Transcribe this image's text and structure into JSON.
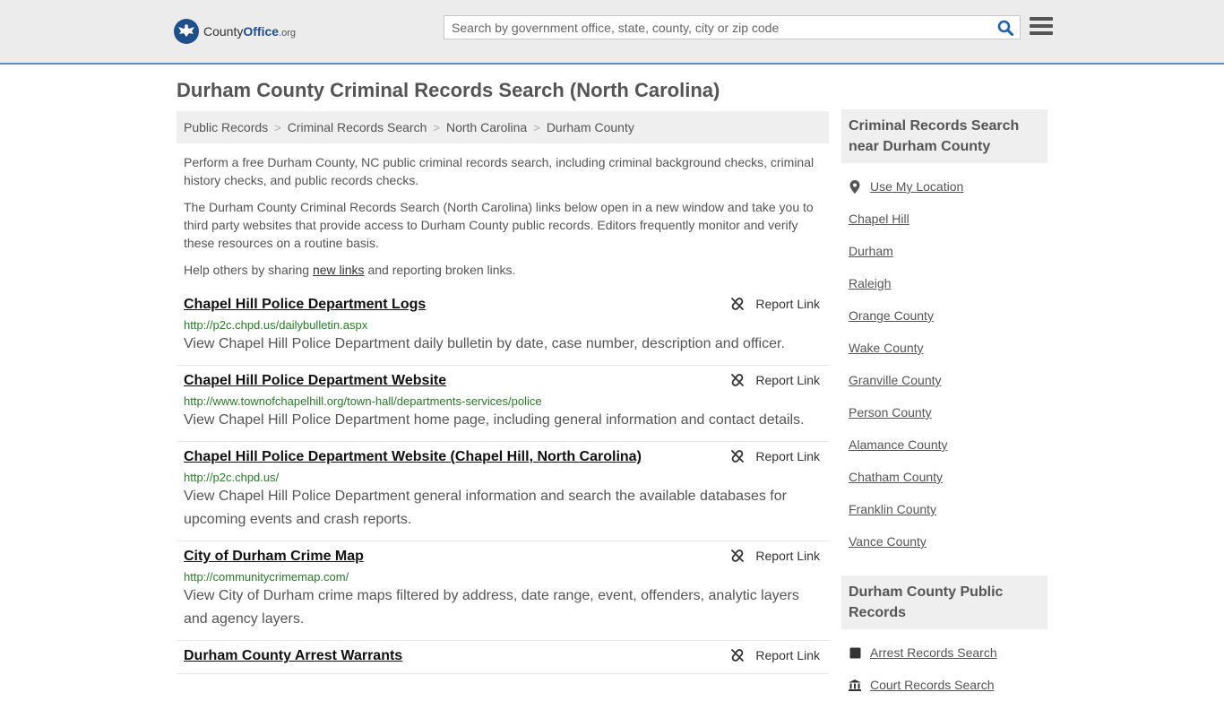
{
  "header": {
    "logo": {
      "county": "County",
      "office": "Office",
      "tld": ".org"
    },
    "search": {
      "placeholder": "Search by government office, state, county, city or zip code"
    }
  },
  "page": {
    "title": "Durham County Criminal Records Search (North Carolina)"
  },
  "breadcrumb": [
    "Public Records",
    "Criminal Records Search",
    "North Carolina",
    "Durham County"
  ],
  "intro": {
    "p1": "Perform a free Durham County, NC public criminal records search, including criminal background checks, criminal history checks, and public records checks.",
    "p2": "The Durham County Criminal Records Search (North Carolina) links below open in a new window and take you to third party websites that provide access to Durham County public records. Editors frequently monitor and verify these resources on a routine basis.",
    "p3_pre": "Help others by sharing ",
    "p3_link": "new links",
    "p3_post": " and reporting broken links."
  },
  "report_label": "Report Link",
  "results": [
    {
      "title": "Chapel Hill Police Department Logs",
      "url": "http://p2c.chpd.us/dailybulletin.aspx",
      "desc": "View Chapel Hill Police Department daily bulletin by date, case number, description and officer."
    },
    {
      "title": "Chapel Hill Police Department Website",
      "url": "http://www.townofchapelhill.org/town-hall/departments-services/police",
      "desc": "View Chapel Hill Police Department home page, including general information and contact details."
    },
    {
      "title": "Chapel Hill Police Department Website (Chapel Hill, North Carolina)",
      "url": "http://p2c.chpd.us/",
      "desc": "View Chapel Hill Police Department general information and search the available databases for upcoming events and crash reports."
    },
    {
      "title": "City of Durham Crime Map",
      "url": "http://communitycrimemap.com/",
      "desc": "View City of Durham crime maps filtered by address, date range, event, offenders, analytic layers and agency layers."
    },
    {
      "title": "Durham County Arrest Warrants",
      "url": "",
      "desc": ""
    }
  ],
  "sidebar": {
    "nearby_heading": "Criminal Records Search near Durham County",
    "use_location": "Use My Location",
    "nearby": [
      "Chapel Hill",
      "Durham",
      "Raleigh",
      "Orange County",
      "Wake County",
      "Granville County",
      "Person County",
      "Alamance County",
      "Chatham County",
      "Franklin County",
      "Vance County"
    ],
    "public_heading": "Durham County Public Records",
    "public_records": [
      "Arrest Records Search",
      "Court Records Search"
    ]
  }
}
